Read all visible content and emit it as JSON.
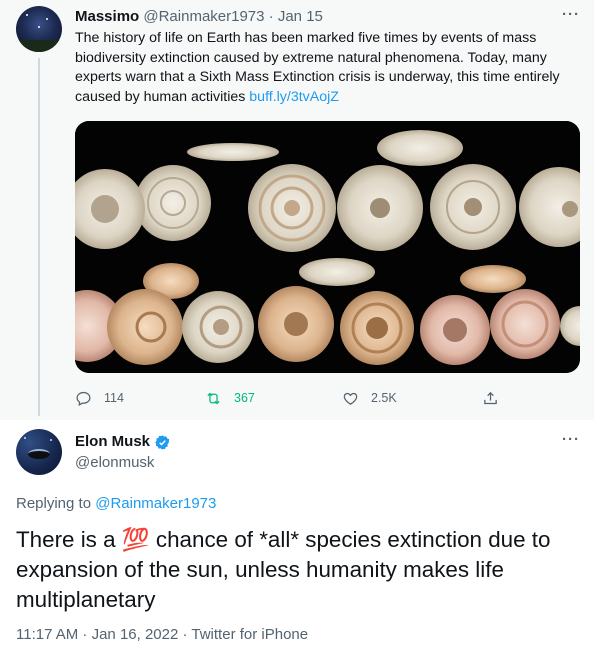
{
  "parent_tweet": {
    "display_name": "Massimo",
    "handle": "@Rainmaker1973",
    "separator": "·",
    "date": "Jan 15",
    "text": "The history of life on Earth has been marked five times by events of mass biodiversity extinction caused by extreme natural phenomena. Today, many experts warn that a Sixth Mass Extinction crisis is underway, this time entirely caused by human activities ",
    "link": "buff.ly/3tvAojZ",
    "actions": {
      "replies": "114",
      "retweets": "367",
      "likes": "2.5K"
    }
  },
  "main_tweet": {
    "display_name": "Elon Musk",
    "handle": "@elonmusk",
    "replying_prefix": "Replying to ",
    "replying_handle": "@Rainmaker1973",
    "text_before": "There is a ",
    "emoji": "💯",
    "text_after": " chance of *all* species extinction due to expansion of the sun, unless humanity makes life multiplanetary",
    "timestamp": "11:17 AM · Jan 16, 2022 · Twitter for iPhone"
  },
  "icons": {
    "more": "more-icon",
    "reply": "reply-icon",
    "retweet": "retweet-icon",
    "like": "like-icon",
    "share": "share-icon",
    "verified": "verified-badge-icon"
  },
  "colors": {
    "accent": "#1d9bf0",
    "retweet_active": "#00ba7c",
    "secondary_text": "#536471"
  }
}
